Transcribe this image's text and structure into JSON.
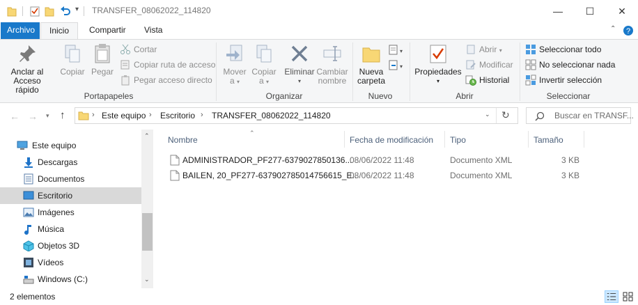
{
  "window": {
    "title": "TRANSFER_08062022_114820",
    "controls": {
      "minimize": "—",
      "maximize": "☐",
      "close": "✕"
    }
  },
  "tabs": [
    "Archivo",
    "Inicio",
    "Compartir",
    "Vista"
  ],
  "ribbon": {
    "portapapeles": {
      "group_label": "Portapapeles",
      "anclar_line1": "Anclar al",
      "anclar_line2": "Acceso rápido",
      "copiar": "Copiar",
      "pegar": "Pegar",
      "cortar": "Cortar",
      "copiar_ruta": "Copiar ruta de acceso",
      "pegar_acceso": "Pegar acceso directo"
    },
    "organizar": {
      "group_label": "Organizar",
      "mover_line1": "Mover",
      "mover_line2": "a",
      "copiar_line1": "Copiar",
      "copiar_line2": "a",
      "eliminar": "Eliminar",
      "cambiar_line1": "Cambiar",
      "cambiar_line2": "nombre"
    },
    "nuevo": {
      "group_label": "Nuevo",
      "nueva_line1": "Nueva",
      "nueva_line2": "carpeta"
    },
    "abrir": {
      "group_label": "Abrir",
      "propiedades": "Propiedades",
      "abrir": "Abrir",
      "modificar": "Modificar",
      "historial": "Historial"
    },
    "seleccionar": {
      "group_label": "Seleccionar",
      "todo": "Seleccionar todo",
      "nada": "No seleccionar nada",
      "invertir": "Invertir selección"
    }
  },
  "address": {
    "crumbs": [
      "Este equipo",
      "Escritorio",
      "TRANSFER_08062022_114820"
    ],
    "search_placeholder": "Buscar en TRANSF..."
  },
  "nav": [
    {
      "label": "Este equipo",
      "icon": "pc-icon"
    },
    {
      "label": "Descargas",
      "icon": "download-icon"
    },
    {
      "label": "Documentos",
      "icon": "documents-icon"
    },
    {
      "label": "Escritorio",
      "icon": "desktop-icon"
    },
    {
      "label": "Imágenes",
      "icon": "pictures-icon"
    },
    {
      "label": "Música",
      "icon": "music-icon"
    },
    {
      "label": "Objetos 3D",
      "icon": "3d-objects-icon"
    },
    {
      "label": "Vídeos",
      "icon": "videos-icon"
    },
    {
      "label": "Windows (C:)",
      "icon": "drive-icon"
    }
  ],
  "columns": {
    "name": "Nombre",
    "date": "Fecha de modificación",
    "type": "Tipo",
    "size": "Tamaño"
  },
  "files": [
    {
      "name": "ADMINISTRADOR_PF277-6379027850136...",
      "date": "08/06/2022 11:48",
      "type": "Documento XML",
      "size": "3 KB"
    },
    {
      "name": "BAILEN, 20_PF277-637902785014756615_E...",
      "date": "08/06/2022 11:48",
      "type": "Documento XML",
      "size": "3 KB"
    }
  ],
  "status": {
    "count": "2 elementos"
  },
  "colors": {
    "accent": "#1979ca",
    "selected_nav": "#d9d9d9",
    "folder": "#f8d775"
  }
}
